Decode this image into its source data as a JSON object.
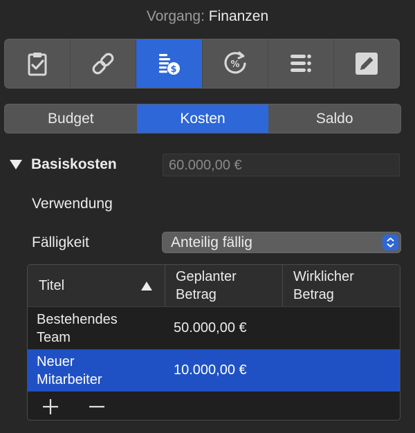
{
  "header": {
    "label": "Vorgang:",
    "value": "Finanzen"
  },
  "iconbar": {
    "items": [
      {
        "icon": "clipboard-check-icon",
        "active": false
      },
      {
        "icon": "link-icon",
        "active": false
      },
      {
        "icon": "finance-icon",
        "active": true
      },
      {
        "icon": "percent-progress-icon",
        "active": false
      },
      {
        "icon": "list-icon",
        "active": false
      },
      {
        "icon": "edit-icon",
        "active": false
      }
    ]
  },
  "tabs": [
    {
      "label": "Budget",
      "active": false
    },
    {
      "label": "Kosten",
      "active": true
    },
    {
      "label": "Saldo",
      "active": false
    }
  ],
  "basiskosten": {
    "label": "Basiskosten",
    "value": "60.000,00 €"
  },
  "verwendung": {
    "label": "Verwendung"
  },
  "faelligkeit": {
    "label": "Fälligkeit",
    "value": "Anteilig fällig"
  },
  "table": {
    "columns": [
      "Titel",
      "Geplanter Betrag",
      "Wirklicher Betrag"
    ],
    "col1_header": "Titel",
    "col2_header_line1": "Geplanter",
    "col2_header_line2": "Betrag",
    "col3_header_line1": "Wirklicher",
    "col3_header_line2": "Betrag",
    "rows": [
      {
        "title_line1": "Bestehendes",
        "title_line2": "Team",
        "planned": "50.000,00 €",
        "actual": "",
        "selected": false
      },
      {
        "title_line1": "Neuer",
        "title_line2": "Mitarbeiter",
        "planned": "10.000,00 €",
        "actual": "",
        "selected": true
      }
    ]
  },
  "colors": {
    "accent": "#2d67d8",
    "selection": "#2051c4",
    "background": "#272727"
  }
}
